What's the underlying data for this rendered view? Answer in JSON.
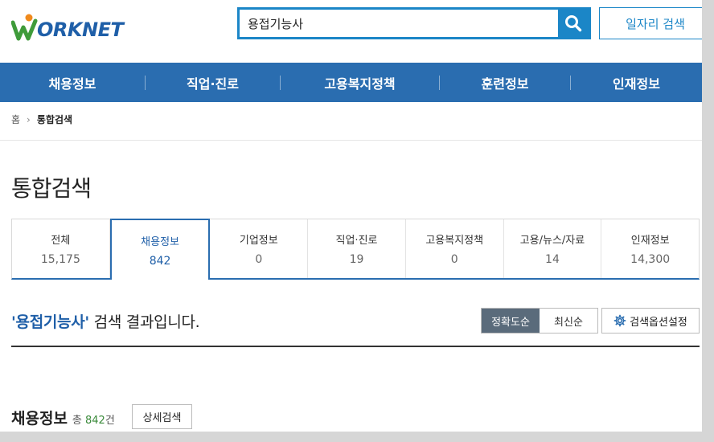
{
  "header": {
    "logo_text": "ORKNET",
    "search": {
      "value": "용접기능사",
      "placeholder": ""
    },
    "job_search_label": "일자리 검색"
  },
  "nav": {
    "items": [
      "채용정보",
      "직업·진로",
      "고용복지정책",
      "훈련정보",
      "인재정보"
    ]
  },
  "breadcrumb": {
    "home": "홈",
    "current": "통합검색"
  },
  "page_title": "통합검색",
  "tabs": [
    {
      "label": "전체",
      "count": "15,175"
    },
    {
      "label": "채용정보",
      "count": "842"
    },
    {
      "label": "기업정보",
      "count": "0"
    },
    {
      "label": "직업·진로",
      "count": "19"
    },
    {
      "label": "고용복지정책",
      "count": "0"
    },
    {
      "label": "고용/뉴스/자료",
      "count": "14"
    },
    {
      "label": "인재정보",
      "count": "14,300"
    }
  ],
  "result": {
    "keyword": "'용접기능사'",
    "suffix": " 검색 결과입니다."
  },
  "sort": {
    "accuracy": "정확도순",
    "latest": "최신순"
  },
  "options_label": "검색옵션설정",
  "section": {
    "title": "채용정보",
    "total_prefix": "총 ",
    "total_count": "842",
    "total_suffix": "건",
    "detail_label": "상세검색"
  },
  "colors": {
    "brand_blue": "#1f5fa8",
    "nav_blue": "#2a6db0",
    "search_blue": "#1b86c7",
    "logo_green": "#3f9b3a",
    "logo_orange": "#f08a1c"
  }
}
